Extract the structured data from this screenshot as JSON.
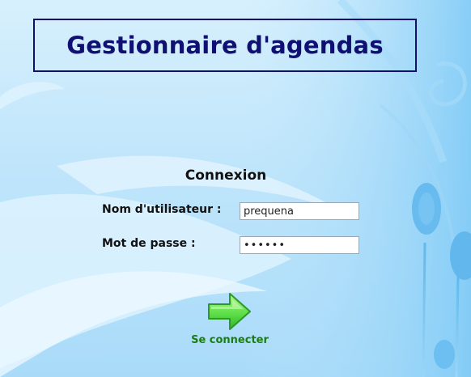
{
  "app": {
    "title": "Gestionnaire d'agendas"
  },
  "login": {
    "heading": "Connexion",
    "username_label": "Nom d'utilisateur :",
    "username_value": "prequena",
    "password_label": "Mot de passe :",
    "password_value": "••••••",
    "submit_label": "Se connecter",
    "submit_icon": "green-arrow-right-icon"
  },
  "colors": {
    "title": "#101073",
    "title_border": "#10106a",
    "submit_text": "#1b7d12",
    "arrow_fill": "#5fe04a"
  }
}
